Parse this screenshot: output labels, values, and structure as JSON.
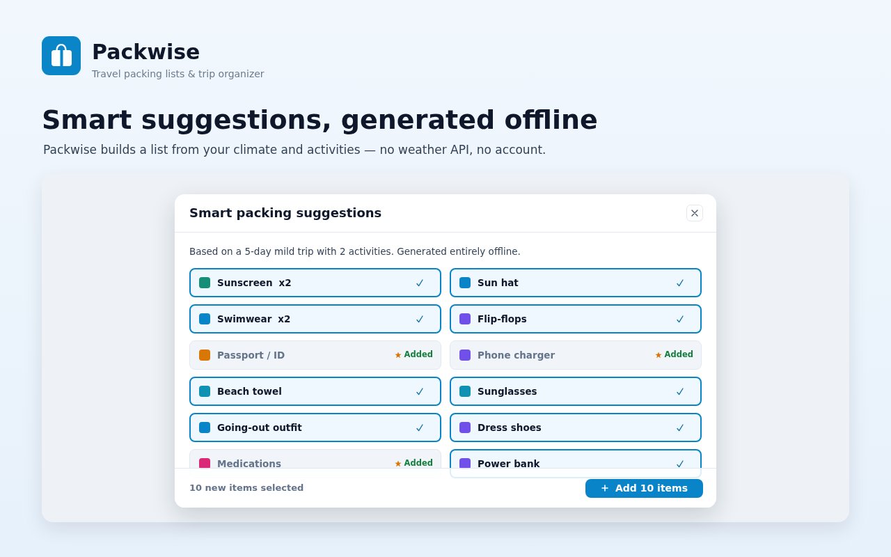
{
  "app": {
    "name": "Packwise",
    "tagline": "Travel packing lists & trip organizer"
  },
  "hero": {
    "title": "Smart suggestions, generated offline",
    "subtitle": "Packwise builds a list from your climate and activities — no weather API, no account."
  },
  "dialog": {
    "title": "Smart packing suggestions",
    "description": "Based on a 5-day mild trip with 2 activities. Generated entirely offline.",
    "items": [
      {
        "name": "Sunscreen",
        "quantity": "x2",
        "color": "#178f77",
        "selected": true,
        "added": false
      },
      {
        "name": "Sun hat",
        "color": "#0a84c8",
        "selected": true,
        "added": false
      },
      {
        "name": "Swimwear",
        "quantity": "x2",
        "color": "#0a84c8",
        "selected": true,
        "added": false
      },
      {
        "name": "Flip-flops",
        "color": "#7150ea",
        "selected": true,
        "added": false
      },
      {
        "name": "Passport / ID",
        "color": "#d97706",
        "selected": false,
        "added": true,
        "badge": "Added"
      },
      {
        "name": "Phone charger",
        "color": "#7150ea",
        "selected": false,
        "added": true,
        "badge": "Added"
      },
      {
        "name": "Beach towel",
        "color": "#0f91b3",
        "selected": true,
        "added": false
      },
      {
        "name": "Sunglasses",
        "color": "#0f91b3",
        "selected": true,
        "added": false
      },
      {
        "name": "Going-out outfit",
        "color": "#0a84c8",
        "selected": true,
        "added": false
      },
      {
        "name": "Dress shoes",
        "color": "#7150ea",
        "selected": true,
        "added": false
      },
      {
        "name": "Medications",
        "color": "#db2777",
        "selected": false,
        "added": true,
        "badge": "Added"
      },
      {
        "name": "Power bank",
        "color": "#7150ea",
        "selected": true,
        "added": false
      }
    ],
    "footer": {
      "summary": "10 new items selected",
      "button": "Add 10 items"
    }
  }
}
